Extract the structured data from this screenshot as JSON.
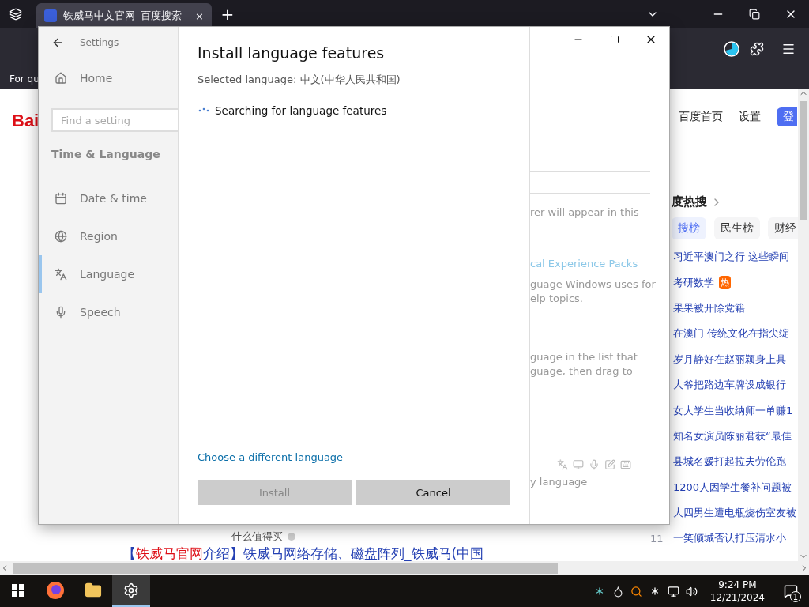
{
  "browser": {
    "tabs": [
      {
        "title": "铁威马中文官网_百度搜索",
        "selected": true,
        "close": "×"
      }
    ],
    "new_tab": "+",
    "bookmark": "For qu"
  },
  "baidu": {
    "logo": "Bai",
    "nav": [
      "百度首页",
      "设置"
    ],
    "login": "登",
    "hot_title": "度热搜",
    "hot_tabs": [
      {
        "label": "搜榜",
        "selected": true
      },
      {
        "label": "民生榜",
        "selected": false
      },
      {
        "label": "财经",
        "selected": false
      }
    ],
    "hot_items": [
      {
        "text": "习近平澳门之行 这些瞬间"
      },
      {
        "text": "考研数学",
        "badge": "热"
      },
      {
        "text": "果果被开除党籍"
      },
      {
        "text": "在澳门 传统文化在指尖绽"
      },
      {
        "text": "岁月静好在赵丽颖身上具"
      },
      {
        "text": "大爷把路边车牌设成银行"
      },
      {
        "text": "女大学生当收纳师一单赚1"
      },
      {
        "text": "知名女演员陈丽君获“最佳"
      },
      {
        "text": "县城名媛打起拉夫劳伦跑"
      },
      {
        "text": "1200人因学生餐补问题被"
      },
      {
        "text": "大四男生遭电瓶烧伤室友被"
      },
      {
        "rank": "11",
        "text": "一笑倾城否认打压清水小"
      }
    ],
    "snippet": "什么值得买",
    "result_title": [
      {
        "text": "【",
        "highlight": false
      },
      {
        "text": "铁威马官网",
        "highlight": true
      },
      {
        "text": "介绍】铁威马网络存储、磁盘阵列_铁威马(中国",
        "highlight": false
      }
    ]
  },
  "settings": {
    "title": "Settings",
    "home": "Home",
    "search_placeholder": "Find a setting",
    "section": "Time & Language",
    "nav": [
      {
        "label": "Date & time",
        "kind": "calendar",
        "selected": false
      },
      {
        "label": "Region",
        "kind": "globe",
        "selected": false
      },
      {
        "label": "Language",
        "kind": "language",
        "selected": true
      },
      {
        "label": "Speech",
        "kind": "mic",
        "selected": false
      }
    ],
    "behind": {
      "lines": [
        "rer will appear in this"
      ],
      "link": "cal Experience Packs",
      "para1": [
        "guage Windows uses for",
        "elp topics."
      ],
      "para2": [
        "guage in the list that",
        "guage, then drag to"
      ],
      "footer": "y language"
    }
  },
  "dialog": {
    "title": "Install language features",
    "selected_language": "Selected language: 中文(中华人民共和国)",
    "status": "Searching for language features",
    "link": "Choose a different language",
    "buttons": [
      {
        "label": "Install",
        "disabled": true
      },
      {
        "label": "Cancel",
        "disabled": false
      }
    ]
  },
  "taskbar": {
    "apps": [
      {
        "kind": "firefox",
        "active": false
      },
      {
        "kind": "folder",
        "active": false
      },
      {
        "kind": "settings",
        "active": true
      }
    ],
    "time": "9:24 PM",
    "date": "12/21/2024",
    "notifications": "1"
  }
}
